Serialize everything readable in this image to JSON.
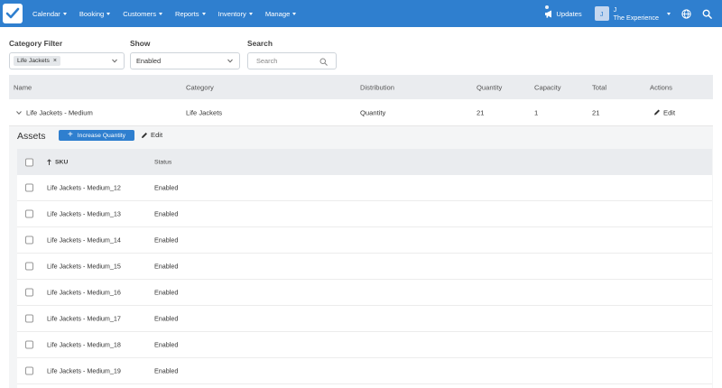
{
  "nav": {
    "menu": [
      {
        "label": "Calendar"
      },
      {
        "label": "Booking"
      },
      {
        "label": "Customers"
      },
      {
        "label": "Reports"
      },
      {
        "label": "Inventory"
      },
      {
        "label": "Manage"
      }
    ],
    "updates_label": "Updates",
    "avatar_initial": "J",
    "user_name": "J",
    "company": "The Experience",
    "colors": {
      "bar": "#2f7fcf"
    }
  },
  "filters": {
    "category": {
      "label": "Category Filter",
      "chip": "Life Jackets",
      "chip_remove": "×"
    },
    "show": {
      "label": "Show",
      "value": "Enabled"
    },
    "search": {
      "label": "Search",
      "placeholder": "Search"
    }
  },
  "table": {
    "columns": [
      "Name",
      "Category",
      "Distribution",
      "Quantity",
      "Capacity",
      "Total",
      "Actions"
    ],
    "row": {
      "name": "Life Jackets - Medium",
      "category": "Life Jackets",
      "distribution": "Quantity",
      "quantity": "21",
      "capacity": "1",
      "total": "21",
      "action": "Edit"
    }
  },
  "assets": {
    "title": "Assets",
    "increase_button": "Increase Quantity",
    "edit_label": "Edit",
    "columns": {
      "sku": "SKU",
      "status": "Status"
    },
    "rows": [
      {
        "sku": "Life Jackets - Medium_12",
        "status": "Enabled"
      },
      {
        "sku": "Life Jackets - Medium_13",
        "status": "Enabled"
      },
      {
        "sku": "Life Jackets - Medium_14",
        "status": "Enabled"
      },
      {
        "sku": "Life Jackets - Medium_15",
        "status": "Enabled"
      },
      {
        "sku": "Life Jackets - Medium_16",
        "status": "Enabled"
      },
      {
        "sku": "Life Jackets - Medium_17",
        "status": "Enabled"
      },
      {
        "sku": "Life Jackets - Medium_18",
        "status": "Enabled"
      },
      {
        "sku": "Life Jackets - Medium_19",
        "status": "Enabled"
      }
    ]
  }
}
